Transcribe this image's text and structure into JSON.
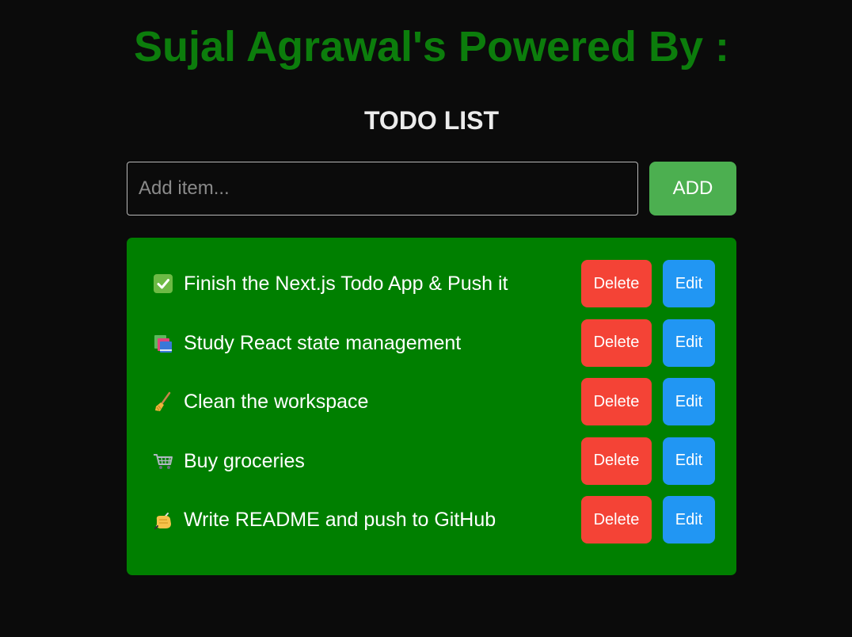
{
  "header": {
    "title": "Sujal Agrawal's Powered By :",
    "subtitle": "TODO LIST"
  },
  "add_form": {
    "placeholder": "Add item...",
    "value": "",
    "add_label": "ADD"
  },
  "todos": [
    {
      "icon": "check-box-icon",
      "text": "Finish the Next.js Todo App & Push it",
      "delete_label": "Delete",
      "edit_label": "Edit"
    },
    {
      "icon": "books-icon",
      "text": "Study React state management",
      "delete_label": "Delete",
      "edit_label": "Edit"
    },
    {
      "icon": "broom-icon",
      "text": "Clean the workspace",
      "delete_label": "Delete",
      "edit_label": "Edit"
    },
    {
      "icon": "shopping-cart-icon",
      "text": "Buy groceries",
      "delete_label": "Delete",
      "edit_label": "Edit"
    },
    {
      "icon": "writing-hand-icon",
      "text": "Write README and push to GitHub",
      "delete_label": "Delete",
      "edit_label": "Edit"
    }
  ],
  "colors": {
    "background": "#0b0b0b",
    "title": "#0c7d0c",
    "list_panel": "#007f00",
    "add_button": "#4caf50",
    "delete_button": "#f44336",
    "edit_button": "#2196f3"
  }
}
